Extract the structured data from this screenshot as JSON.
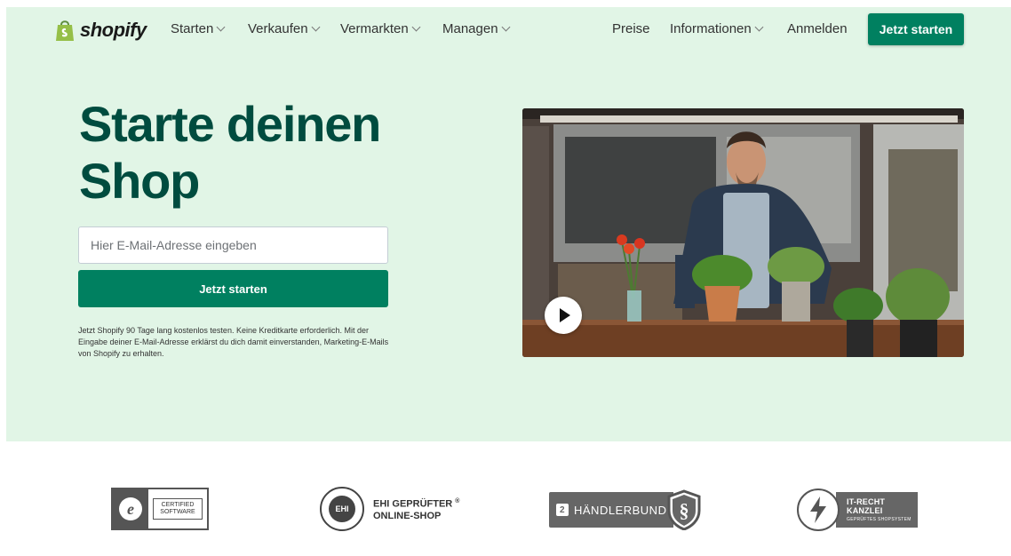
{
  "brand": {
    "logo_text": "shopify",
    "primary_color": "#008060",
    "headline_color": "#004c3f",
    "hero_bg": "#e1f5e6"
  },
  "nav": {
    "items_left": [
      {
        "label": "Starten",
        "has_dropdown": true
      },
      {
        "label": "Verkaufen",
        "has_dropdown": true
      },
      {
        "label": "Vermarkten",
        "has_dropdown": true
      },
      {
        "label": "Managen",
        "has_dropdown": true
      }
    ],
    "pricing": "Preise",
    "info": "Informationen",
    "login": "Anmelden",
    "cta": "Jetzt starten"
  },
  "hero": {
    "headline_line1": "Starte deinen",
    "headline_line2": "Shop",
    "email_placeholder": "Hier E-Mail-Adresse eingeben",
    "cta": "Jetzt starten",
    "disclaimer": "Jetzt Shopify 90 Tage lang kostenlos testen. Keine Kreditkarte erforderlich. Mit der Eingabe deiner E-Mail-Adresse erklärst du dich damit einverstanden, Marketing-E-Mails von Shopify zu erhalten."
  },
  "video": {
    "play_icon": "play-icon"
  },
  "badges": {
    "certified": {
      "line1": "CERTIFIED",
      "line2": "SOFTWARE"
    },
    "ehi": {
      "seal_text": "EHI",
      "line1": "EHI GEPRÜFTER",
      "line2": "ONLINE-SHOP",
      "reg": "®"
    },
    "haendlerbund": {
      "label": "HÄNDLERBUND",
      "icon_char": "§"
    },
    "it_recht": {
      "line1": "IT-RECHT KANZLEI",
      "line2": "GEPRÜFTES SHOPSYSTEM"
    }
  }
}
